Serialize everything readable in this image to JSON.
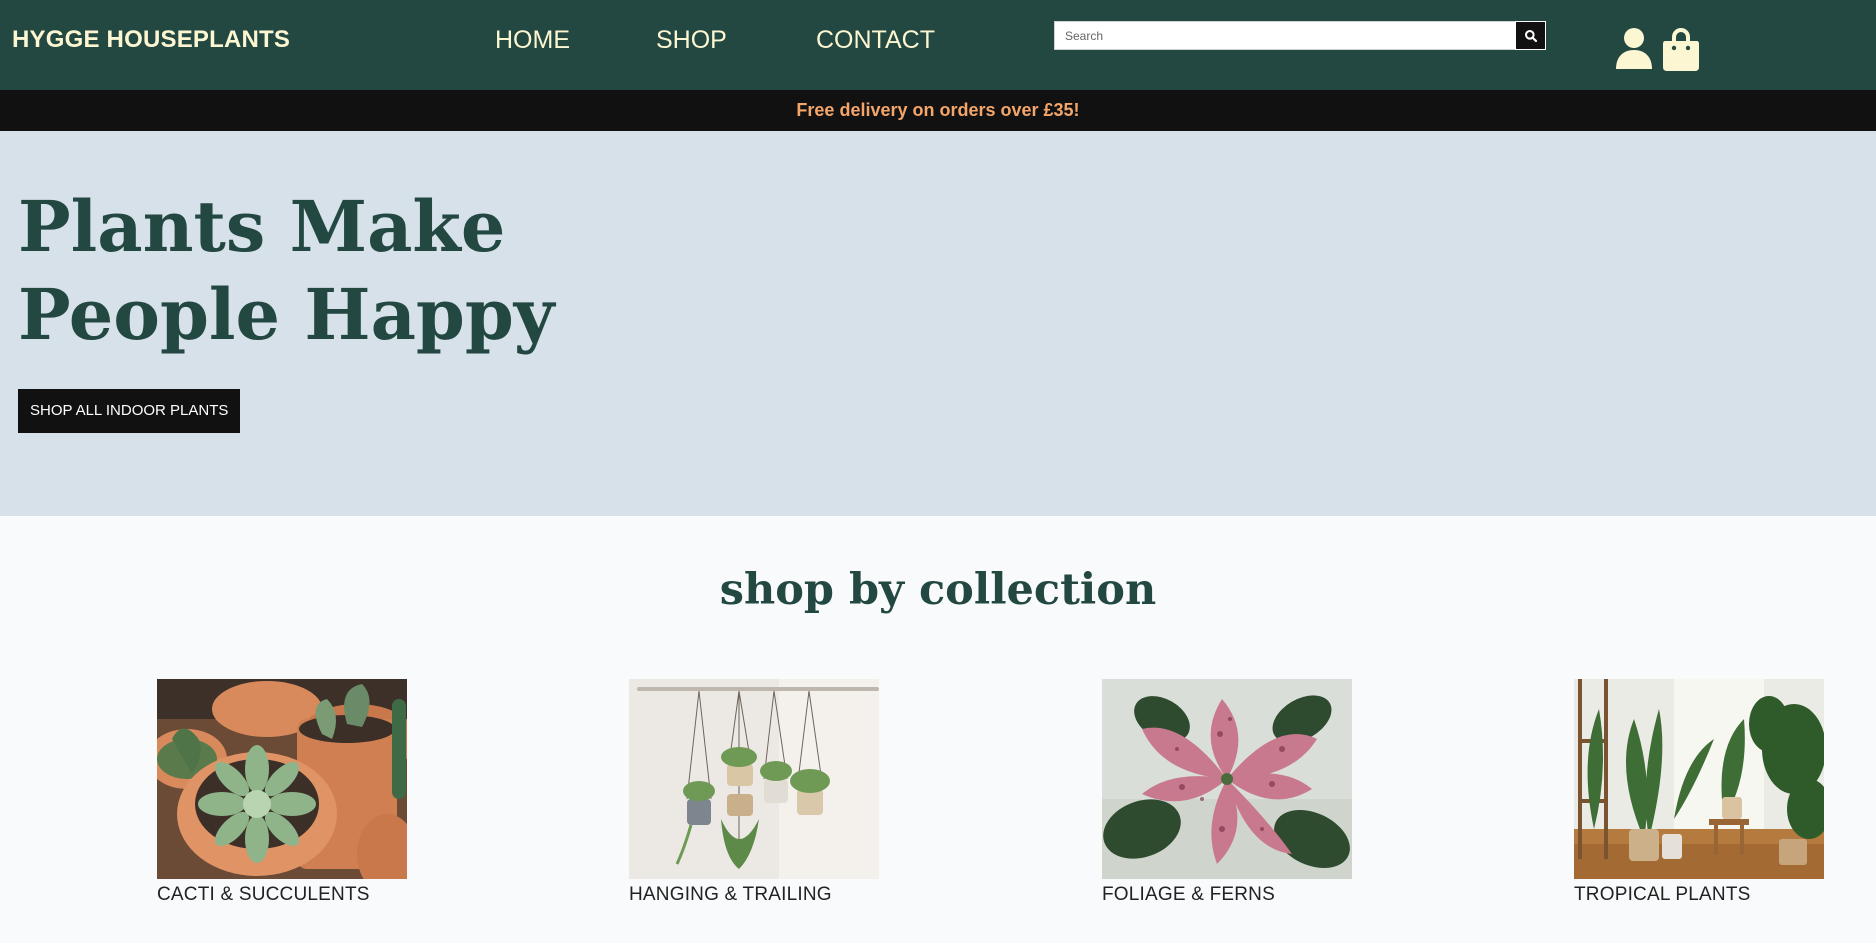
{
  "header": {
    "brand": "HYGGE HOUSEPLANTS",
    "nav": {
      "home": "HOME",
      "shop": "SHOP",
      "contact": "CONTACT"
    },
    "search": {
      "placeholder": "Search",
      "value": ""
    },
    "icons": [
      "user-icon",
      "shopping-bag-icon",
      "search-icon"
    ]
  },
  "promo": {
    "text": "Free delivery on orders over £35!"
  },
  "hero": {
    "title": "Plants Make People Happy",
    "cta": "SHOP ALL INDOOR PLANTS"
  },
  "collections": {
    "heading": "shop by collection",
    "items": [
      {
        "label": "CACTI & SUCCULENTS",
        "image": "terracotta-pots-cacti-succulents"
      },
      {
        "label": "HANGING & TRAILING",
        "image": "hanging-macrame-planters"
      },
      {
        "label": "FOLIAGE & FERNS",
        "image": "pink-polka-dot-leaves"
      },
      {
        "label": "TROPICAL PLANTS",
        "image": "tropical-plants-room"
      }
    ]
  },
  "colors": {
    "header_bg": "#234842",
    "header_text": "#fdf6d2",
    "promo_bg": "#111111",
    "promo_text": "#f3a56a",
    "hero_bg": "#d7e1e9",
    "heading_text": "#234842",
    "page_bg": "#f8fafb"
  }
}
